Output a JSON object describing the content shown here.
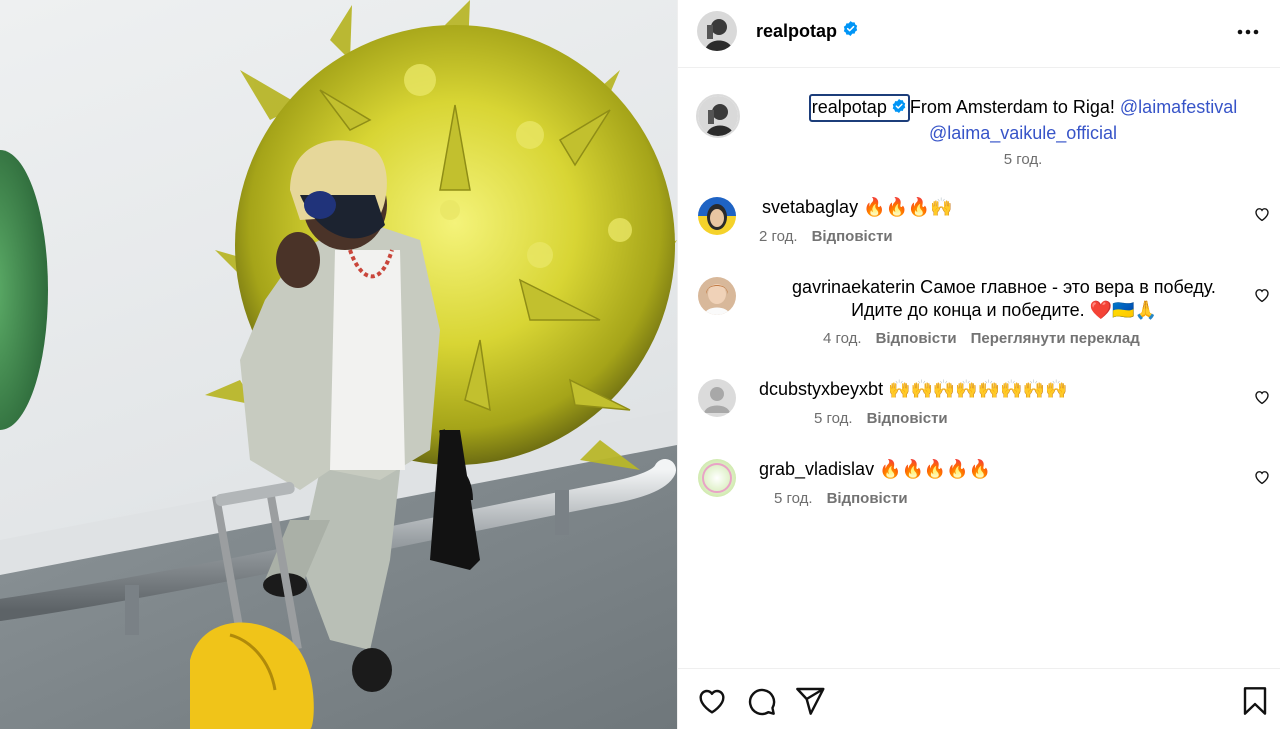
{
  "post": {
    "author": "realpotap",
    "verified": true
  },
  "caption": {
    "user": "realpotap",
    "text": "From Amsterdam to Riga!",
    "mention_1": "@laimafestival",
    "mention_2": "@laima_vaikule_official",
    "time": "5 год."
  },
  "comments": [
    {
      "user": "svetabaglay",
      "text": "🔥🔥🔥🙌",
      "time": "2 год.",
      "reply": "Відповісти"
    },
    {
      "user": "gavrinaekaterin",
      "text_line1": "Самое главное - это вера в победу.",
      "text_line2": "Идите до конца и победите. ❤️🇺🇦🙏",
      "time": "4 год.",
      "reply": "Відповісти",
      "translate": "Переглянути переклад"
    },
    {
      "user": "dcubstyxbeyxbt",
      "text": "🙌🙌🙌🙌🙌🙌🙌🙌",
      "time": "5 год.",
      "reply": "Відповісти"
    },
    {
      "user": "grab_vladislav",
      "text": "🔥🔥🔥🔥🔥",
      "time": "5 год.",
      "reply": "Відповісти"
    }
  ],
  "icons": [
    "more-icon",
    "verified-icon",
    "heart-icon",
    "comment-icon",
    "share-icon",
    "bookmark-icon"
  ],
  "colors": {
    "link": "#3754c8",
    "verified": "#0095f6",
    "meta": "#737373",
    "divider": "#efefef"
  }
}
